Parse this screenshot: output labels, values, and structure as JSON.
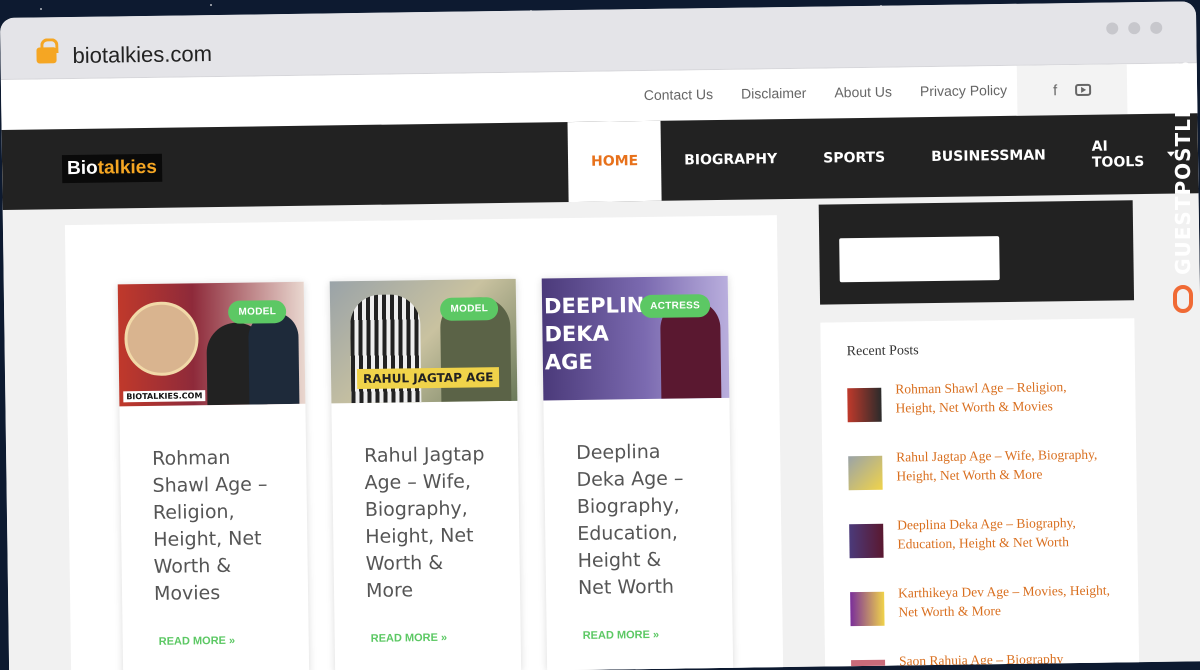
{
  "browser": {
    "url": "biotalkies.com"
  },
  "top_links": [
    "Contact Us",
    "Disclaimer",
    "About Us",
    "Privacy Policy"
  ],
  "social": {
    "facebook": "f"
  },
  "logo": {
    "part1": "Bio",
    "part2": "talkies"
  },
  "nav": {
    "home": "HOME",
    "biography": "BIOGRAPHY",
    "sports": "SPORTS",
    "businessman": "BUSINESSMAN",
    "ai_tools": "AI TOOLS"
  },
  "posts": [
    {
      "badge": "MODEL",
      "title": "Rohman Shawl Age – Religion, Height, Net Worth & Movies",
      "read_more": "READ MORE »",
      "image_text": "BIOTALKIES.COM"
    },
    {
      "badge": "MODEL",
      "title": "Rahul Jagtap Age – Wife, Biography, Height, Net Worth & More",
      "read_more": "READ MORE »",
      "image_text": "RAHUL JAGTAP AGE"
    },
    {
      "badge": "ACTRESS",
      "title": "Deeplina Deka Age – Biography, Education, Height & Net Worth",
      "read_more": "READ MORE »",
      "image_text": "DEEPLINA DEKA AGE"
    }
  ],
  "sidebar": {
    "recent_title": "Recent Posts",
    "recent": [
      "Rohman Shawl Age – Religion, Height, Net Worth & Movies",
      "Rahul Jagtap Age – Wife, Biography, Height, Net Worth & More",
      "Deeplina Deka Age – Biography, Education, Height & Net Worth",
      "Karthikeya Dev Age – Movies, Height, Net Worth & More",
      "Saon Rahuia Age – Biography"
    ]
  },
  "watermark": "GUESTPOSTLINKS",
  "colors": {
    "accent": "#e7711b",
    "badge": "#5cc864",
    "link": "#d96f1f",
    "nav_bg": "#222222"
  }
}
